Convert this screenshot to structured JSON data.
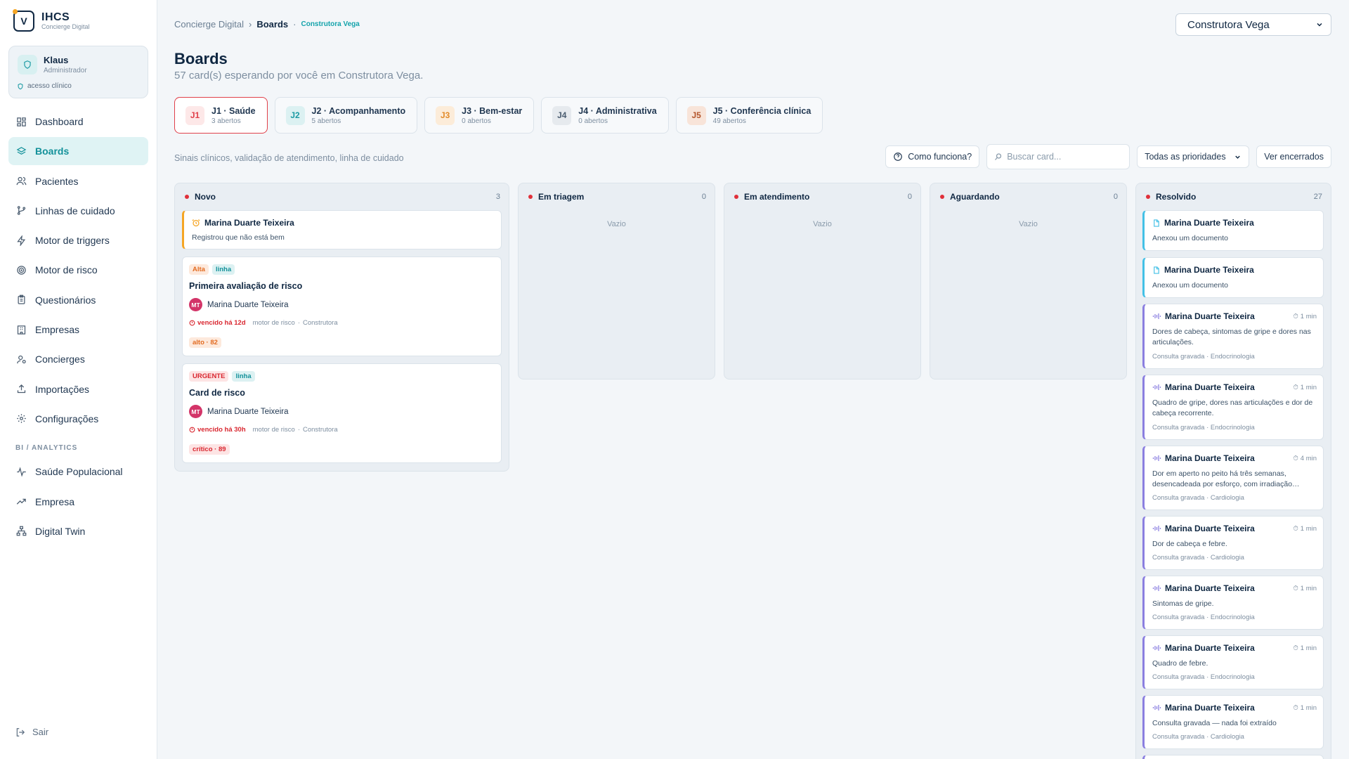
{
  "brand": {
    "name": "IHCS",
    "subtitle": "Concierge Digital",
    "logo_letter": "V"
  },
  "user": {
    "name": "Klaus",
    "role": "Administrador",
    "access": "acesso clínico"
  },
  "nav": {
    "items": [
      {
        "label": "Dashboard",
        "icon": "grid-icon"
      },
      {
        "label": "Boards",
        "icon": "layers-icon"
      },
      {
        "label": "Pacientes",
        "icon": "users-icon"
      },
      {
        "label": "Linhas de cuidado",
        "icon": "git-branch-icon"
      },
      {
        "label": "Motor de triggers",
        "icon": "bolt-icon"
      },
      {
        "label": "Motor de risco",
        "icon": "target-icon"
      },
      {
        "label": "Questionários",
        "icon": "clipboard-icon"
      },
      {
        "label": "Empresas",
        "icon": "building-icon"
      },
      {
        "label": "Concierges",
        "icon": "user-cog-icon"
      },
      {
        "label": "Importações",
        "icon": "upload-icon"
      },
      {
        "label": "Configurações",
        "icon": "gear-icon"
      }
    ],
    "section_label": "BI / ANALYTICS",
    "analytics": [
      {
        "label": "Saúde Populacional",
        "icon": "activity-icon"
      },
      {
        "label": "Empresa",
        "icon": "trending-up-icon"
      },
      {
        "label": "Digital Twin",
        "icon": "network-icon"
      }
    ],
    "logout": "Sair"
  },
  "breadcrumb": {
    "root": "Concierge Digital",
    "current": "Boards",
    "company": "Construtora Vega"
  },
  "company_select": {
    "value": "Construtora Vega"
  },
  "page": {
    "title": "Boards",
    "subtitle": "57 card(s) esperando por você em Construtora Vega."
  },
  "tabs": [
    {
      "code": "J1",
      "title": "J1 · Saúde",
      "count": "3 abertos",
      "color": "#e0404a",
      "bg": "#fde8e8"
    },
    {
      "code": "J2",
      "title": "J2 · Acompanhamento",
      "count": "5 abertos",
      "color": "#1b9aa3",
      "bg": "#dcf1f2"
    },
    {
      "code": "J3",
      "title": "J3 · Bem-estar",
      "count": "0 abertos",
      "color": "#e28b2a",
      "bg": "#fcecd9"
    },
    {
      "code": "J4",
      "title": "J4 · Administrativa",
      "count": "0 abertos",
      "color": "#4b5d70",
      "bg": "#e6eaee"
    },
    {
      "code": "J5",
      "title": "J5 · Conferência clínica",
      "count": "49 abertos",
      "color": "#b4562c",
      "bg": "#f8e4d9"
    }
  ],
  "board_description": "Sinais clínicos, validação de atendimento, linha de cuidado",
  "toolbar": {
    "help_label": "Como funciona?",
    "search_placeholder": "Buscar card...",
    "priority_value": "Todas as prioridades",
    "closed_label": "Ver encerrados"
  },
  "columns": [
    {
      "name": "Novo",
      "count": "3"
    },
    {
      "name": "Em triagem",
      "count": "0",
      "empty": "Vazio"
    },
    {
      "name": "Em atendimento",
      "count": "0",
      "empty": "Vazio"
    },
    {
      "name": "Aguardando",
      "count": "0",
      "empty": "Vazio"
    },
    {
      "name": "Resolvido",
      "count": "27"
    }
  ],
  "novo_cards": {
    "alert": {
      "name": "Marina Duarte Teixeira",
      "text": "Registrou que não está bem"
    },
    "risk1": {
      "priority": "Alta",
      "tag": "linha",
      "title": "Primeira avaliação de risco",
      "initials": "MT",
      "patient": "Marina Duarte Teixeira",
      "overdue": "vencido há 12d",
      "source": "motor de risco",
      "sep": "·",
      "company": "Construtora",
      "score": "alto · 82"
    },
    "risk2": {
      "priority": "URGENTE",
      "tag": "linha",
      "title": "Card de risco",
      "initials": "MT",
      "patient": "Marina Duarte Teixeira",
      "overdue": "vencido há 30h",
      "source": "motor de risco",
      "sep": "·",
      "company": "Construtora",
      "score": "crítico · 89"
    }
  },
  "resolved_cards": [
    {
      "type": "doc",
      "name": "Marina Duarte Teixeira",
      "text": "Anexou um documento"
    },
    {
      "type": "doc",
      "name": "Marina Duarte Teixeira",
      "text": "Anexou um documento"
    },
    {
      "type": "audio",
      "name": "Marina Duarte Teixeira",
      "time": "1 min",
      "text": "Dores de cabeça, sintomas de gripe e dores nas articulações.",
      "footer": "Consulta gravada · Endocrinologia"
    },
    {
      "type": "audio",
      "name": "Marina Duarte Teixeira",
      "time": "1 min",
      "text": "Quadro de gripe, dores nas articulações e dor de cabeça recorrente.",
      "footer": "Consulta gravada · Endocrinologia"
    },
    {
      "type": "audio",
      "name": "Marina Duarte Teixeira",
      "time": "4 min",
      "text": "Dor em aperto no peito há três semanas, desencadeada por esforço, com irradiação…",
      "footer": "Consulta gravada · Cardiologia"
    },
    {
      "type": "audio",
      "name": "Marina Duarte Teixeira",
      "time": "1 min",
      "text": "Dor de cabeça e febre.",
      "footer": "Consulta gravada · Cardiologia"
    },
    {
      "type": "audio",
      "name": "Marina Duarte Teixeira",
      "time": "1 min",
      "text": "Sintomas de gripe.",
      "footer": "Consulta gravada · Endocrinologia"
    },
    {
      "type": "audio",
      "name": "Marina Duarte Teixeira",
      "time": "1 min",
      "text": "Quadro de febre.",
      "footer": "Consulta gravada · Endocrinologia"
    },
    {
      "type": "audio",
      "name": "Marina Duarte Teixeira",
      "time": "1 min",
      "text": "Consulta gravada — nada foi extraído",
      "footer": "Consulta gravada · Cardiologia"
    }
  ]
}
